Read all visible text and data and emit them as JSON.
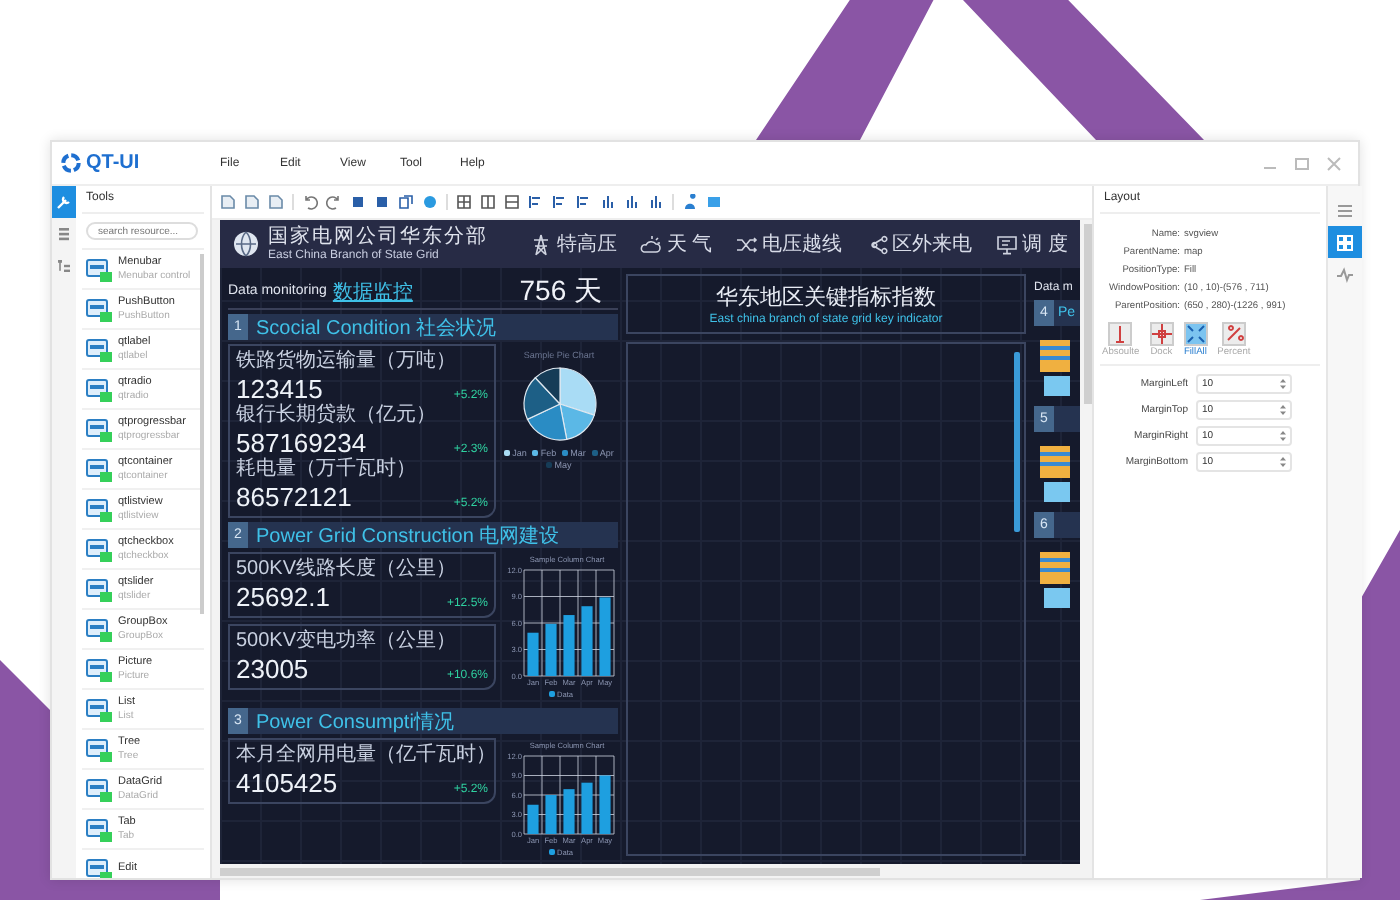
{
  "window": {
    "app_name": "QT-UI",
    "menu": [
      "File",
      "Edit",
      "View",
      "Tool",
      "Help"
    ]
  },
  "left_rail": [
    {
      "kind": "wrench",
      "selected": true
    },
    {
      "kind": "list",
      "selected": false
    },
    {
      "kind": "tree",
      "selected": false
    }
  ],
  "tools": {
    "title": "Tools",
    "search": {
      "placeholder": "search resource..."
    },
    "items": [
      {
        "name": "Menubar",
        "description": "Menubar control"
      },
      {
        "name": "PushButton",
        "description": "PushButton"
      },
      {
        "name": "qtlabel",
        "description": "qtlabel"
      },
      {
        "name": "qtradio",
        "description": "qtradio"
      },
      {
        "name": "qtprogressbar",
        "description": "qtprogressbar"
      },
      {
        "name": "qtcontainer",
        "description": "qtcontainer"
      },
      {
        "name": "qtlistview",
        "description": "qtlistview"
      },
      {
        "name": "qtcheckbox",
        "description": "qtcheckbox"
      },
      {
        "name": "qtslider",
        "description": "qtslider"
      },
      {
        "name": "GroupBox",
        "description": "GroupBox"
      },
      {
        "name": "Picture",
        "description": "Picture"
      },
      {
        "name": "List",
        "description": "List"
      },
      {
        "name": "Tree",
        "description": "Tree"
      },
      {
        "name": "DataGrid",
        "description": "DataGrid"
      },
      {
        "name": "Tab",
        "description": "Tab"
      },
      {
        "name": "Edit"
      }
    ]
  },
  "dashboard": {
    "org_name": "国家电网公司华东分部",
    "org_name_en": "East China Branch of State Grid",
    "nav": [
      {
        "kind": "tower",
        "label": "特高压"
      },
      {
        "kind": "cloud",
        "label": "天 气"
      },
      {
        "kind": "shuffle",
        "label": "电压越线"
      },
      {
        "kind": "share",
        "label": "区外来电"
      },
      {
        "kind": "monitor",
        "label": "调 度"
      }
    ],
    "monitoring": {
      "label": "Data monitoring",
      "label_zh": "数据监控",
      "days": "756 天"
    },
    "sections": [
      {
        "number": "1",
        "title": "Scocial Condition 社会状况",
        "cards": [
          {
            "stats": [
              {
                "label": "铁路货物运输量（万吨）",
                "value": "123415",
                "change": "+5.2%"
              },
              {
                "label": "银行长期贷款（亿元）",
                "value": "587169234",
                "change": "+2.3%"
              },
              {
                "label": "耗电量（万千瓦时）",
                "value": "86572121",
                "change": "+5.2%"
              }
            ]
          }
        ],
        "chart": {
          "kind": "pie",
          "title": "Sample Pie Chart",
          "legend": [
            {
              "label": "Jan",
              "color": "#a9dcf5"
            },
            {
              "label": "Feb",
              "color": "#5bb8e6"
            },
            {
              "label": "Mar",
              "color": "#2a8cc4"
            },
            {
              "label": "Apr",
              "color": "#1d5f86"
            },
            {
              "label": "May",
              "color": "#163c57"
            }
          ]
        }
      },
      {
        "number": "2",
        "title": "Power Grid Construction 电网建设",
        "cards": [
          {
            "stats": [
              {
                "label": "500KV线路长度（公里）",
                "value": "25692.1",
                "change": "+12.5%"
              }
            ]
          },
          {
            "stats": [
              {
                "label": "500KV变电功率（公里）",
                "value": "23005",
                "change": "+10.6%"
              }
            ]
          }
        ],
        "chart": {
          "kind": "column",
          "chart_data": {
            "type": "bar",
            "title": "Sample Column Chart",
            "categories": [
              "Jan",
              "Feb",
              "Mar",
              "Apr",
              "May"
            ],
            "series": [
              {
                "name": "Data",
                "color": "#1e9fe0",
                "values": [
                  4.9,
                  5.9,
                  6.9,
                  7.9,
                  8.9
                ]
              }
            ],
            "grid": true,
            "ylim": [
              0,
              12
            ],
            "yticks": [
              {
                "value": 0,
                "label": "0.0"
              },
              {
                "value": 3,
                "label": "3.0"
              },
              {
                "value": 6,
                "label": "6.0"
              },
              {
                "value": 9,
                "label": "9.0"
              },
              {
                "value": 12,
                "label": "12.0"
              }
            ]
          }
        }
      },
      {
        "number": "3",
        "title": "Power Consumpti情况",
        "cards": [
          {
            "stats": [
              {
                "label": "本月全网用电量（亿千瓦时）",
                "value": "4105425",
                "change": "+5.2%"
              }
            ]
          }
        ],
        "chart": {
          "kind": "column",
          "chart_data": {
            "type": "bar",
            "title": "Sample Column Chart",
            "categories": [
              "Jan",
              "Feb",
              "Mar",
              "Apr",
              "May"
            ],
            "series": [
              {
                "name": "Data",
                "color": "#1e9fe0",
                "values": [
                  4.5,
                  6.0,
                  6.9,
                  7.9,
                  9.0
                ]
              }
            ],
            "grid": true,
            "ylim": [
              0,
              12
            ],
            "yticks": [
              {
                "value": 0,
                "label": "0.0"
              },
              {
                "value": 3,
                "label": "3.0"
              },
              {
                "value": 6,
                "label": "6.0"
              },
              {
                "value": 9,
                "label": "9.0"
              },
              {
                "value": 12,
                "label": "12.0"
              }
            ]
          }
        }
      }
    ],
    "center": {
      "title": "华东地区关键指标指数",
      "subtitle": "East china branch of state grid key indicator"
    },
    "right_strip": {
      "label": "Data m",
      "sections": [
        {
          "number": "4",
          "title": "Pe"
        },
        {
          "number": "5"
        },
        {
          "number": "6"
        }
      ]
    }
  },
  "layout_panel": {
    "title": "Layout",
    "properties": [
      {
        "label": "Name:",
        "value": "svgview"
      },
      {
        "label": "ParentName:",
        "value": "map"
      },
      {
        "label": "PositionType:",
        "value": "Fill"
      },
      {
        "label": "WindowPosition:",
        "value": "(10 , 10)-(576 , 711)"
      },
      {
        "label": "ParentPosition:",
        "value": "(650 , 280)-(1226 , 991)"
      }
    ],
    "modes": [
      {
        "kind": "absolute",
        "label": "Absoulte",
        "selected": false
      },
      {
        "kind": "dock",
        "label": "Dock",
        "selected": false
      },
      {
        "kind": "fill",
        "label": "FillAll",
        "selected": true
      },
      {
        "kind": "percent",
        "label": "Percent",
        "selected": false
      }
    ],
    "margins": [
      {
        "label": "MarginLeft",
        "value": "10"
      },
      {
        "label": "MarginTop",
        "value": "10"
      },
      {
        "label": "MarginRight",
        "value": "10"
      },
      {
        "label": "MarginBottom",
        "value": "10"
      }
    ]
  },
  "right_rail": [
    {
      "kind": "list",
      "selected": false
    },
    {
      "kind": "grid",
      "selected": true
    },
    {
      "kind": "pulse",
      "selected": false
    }
  ]
}
